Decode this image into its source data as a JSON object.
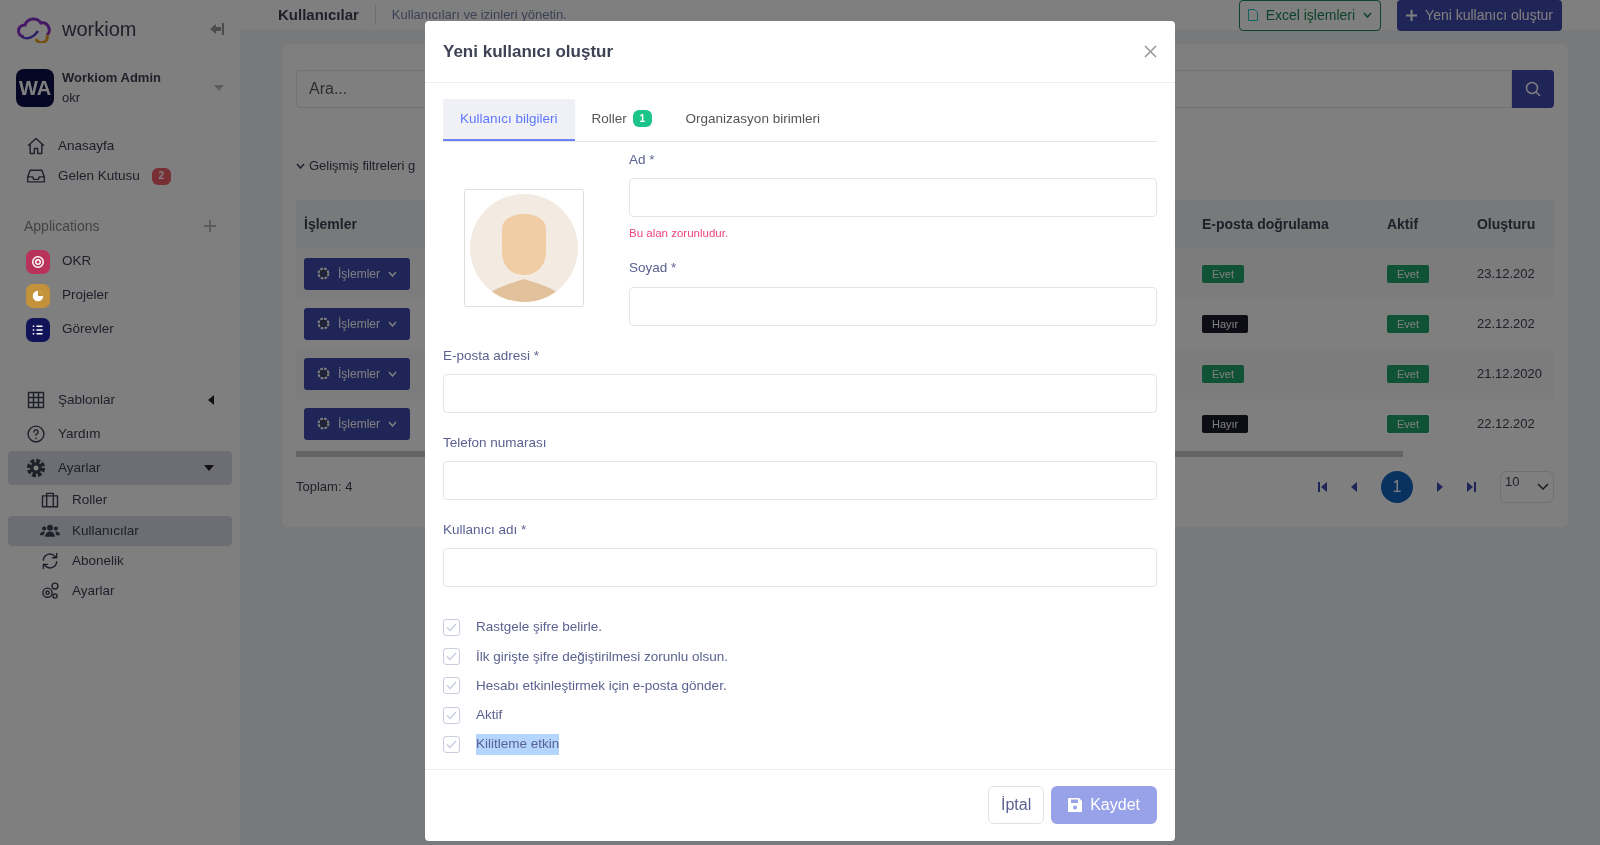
{
  "sidebar": {
    "logo": "workiom",
    "user": {
      "initials": "WA",
      "name": "Workiom Admin",
      "workspace": "okr"
    },
    "nav": [
      {
        "label": "Anasayfa"
      },
      {
        "label": "Gelen Kutusu",
        "badge": "2"
      }
    ],
    "apps_title": "Applications",
    "apps": [
      {
        "label": "OKR",
        "color": "#b8325a"
      },
      {
        "label": "Projeler",
        "color": "#c4923a"
      },
      {
        "label": "Görevler",
        "color": "#12145a"
      }
    ],
    "menu": [
      {
        "label": "Şablonlar",
        "kind": "group",
        "expanded": false,
        "selected": false
      },
      {
        "label": "Yardım",
        "kind": "link",
        "selected": false
      },
      {
        "label": "Ayarlar",
        "kind": "group",
        "expanded": true,
        "selected": true,
        "children": [
          {
            "label": "Roller",
            "selected": false
          },
          {
            "label": "Kullanıcılar",
            "selected": true
          },
          {
            "label": "Abonelik",
            "selected": false
          },
          {
            "label": "Ayarlar",
            "selected": false
          }
        ]
      }
    ]
  },
  "header": {
    "title": "Kullanıcılar",
    "subtitle": "Kullanıcıları ve izinleri yönetin.",
    "excel_button": "Excel işlemleri",
    "new_button": "Yeni kullanıcı oluştur"
  },
  "content": {
    "search": {
      "placeholder": "Ara..."
    },
    "filter_toggle": "Gelişmiş filtreleri g",
    "table": {
      "columns": [
        "İşlemler",
        "E-posta doğrulama",
        "Aktif",
        "Oluşturu"
      ],
      "rows": [
        {
          "action": "İşlemler",
          "email_verified": {
            "text": "Evet",
            "positive": true
          },
          "active": {
            "text": "Evet",
            "positive": true
          },
          "created": "23.12.202"
        },
        {
          "action": "İşlemler",
          "email_verified": {
            "text": "Hayır",
            "positive": false
          },
          "active": {
            "text": "Evet",
            "positive": true
          },
          "created": "22.12.202"
        },
        {
          "action": "İşlemler",
          "email_verified": {
            "text": "Evet",
            "positive": true
          },
          "active": {
            "text": "Evet",
            "positive": true
          },
          "created": "21.12.2020"
        },
        {
          "action": "İşlemler",
          "email_verified": {
            "text": "Hayır",
            "positive": false
          },
          "active": {
            "text": "Evet",
            "positive": true
          },
          "created": "22.12.202"
        }
      ]
    },
    "total": "Toplam: 4",
    "pages": [
      {
        "label": "1",
        "selected": true
      }
    ],
    "page_size": "10"
  },
  "modal": {
    "title": "Yeni kullanıcı oluştur",
    "tabs": [
      {
        "label": "Kullanıcı bilgileri",
        "selected": true
      },
      {
        "label": "Roller",
        "badge": "1",
        "selected": false
      },
      {
        "label": "Organizasyon birimleri",
        "selected": false
      }
    ],
    "name_fields": [
      {
        "label": "Ad *",
        "error": "Bu alan zorunludur."
      },
      {
        "label": "Soyad *"
      }
    ],
    "fields": [
      {
        "label": "E-posta adresi *"
      },
      {
        "label": "Telefon numarası"
      },
      {
        "label": "Kullanıcı adı *"
      }
    ],
    "checkboxes": [
      {
        "label": "Rastgele şifre belirle.",
        "checked": false,
        "text_selected": false
      },
      {
        "label": "İlk girişte şifre değiştirilmesi zorunlu olsun.",
        "checked": false,
        "text_selected": false
      },
      {
        "label": "Hesabı etkinleştirmek için e-posta gönder.",
        "checked": false,
        "text_selected": false
      },
      {
        "label": "Aktif",
        "checked": false,
        "text_selected": false
      },
      {
        "label": "Kilitleme etkin",
        "checked": false,
        "text_selected": true
      }
    ],
    "cancel_button": "İptal",
    "save_button": "Kaydet"
  }
}
